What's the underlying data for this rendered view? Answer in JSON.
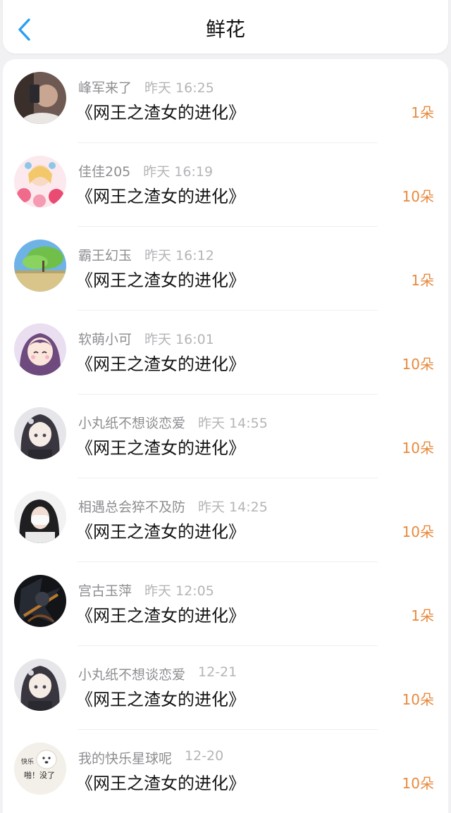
{
  "header": {
    "title": "鲜花",
    "back_icon": "chevron-left-icon",
    "accent_color": "#2a9df4"
  },
  "count_color": "#e8893c",
  "items": [
    {
      "name": "峰军来了",
      "time": "昨天 16:25",
      "book": "《网王之渣女的进化》",
      "count": "1朵",
      "avatar": "photo-avatar-icon"
    },
    {
      "name": "佳佳205",
      "time": "昨天 16:19",
      "book": "《网王之渣女的进化》",
      "count": "10朵",
      "avatar": "anime-girl-avatar-icon"
    },
    {
      "name": "霸王幻玉",
      "time": "昨天 16:12",
      "book": "《网王之渣女的进化》",
      "count": "1朵",
      "avatar": "landscape-avatar-icon"
    },
    {
      "name": "软萌小可",
      "time": "昨天 16:01",
      "book": "《网王之渣女的进化》",
      "count": "10朵",
      "avatar": "anime-girl-avatar-icon"
    },
    {
      "name": "小丸纸不想谈恋爱",
      "time": "昨天 14:55",
      "book": "《网王之渣女的进化》",
      "count": "10朵",
      "avatar": "anime-girl-avatar-icon"
    },
    {
      "name": "相遇总会猝不及防",
      "time": "昨天 14:25",
      "book": "《网王之渣女的进化》",
      "count": "10朵",
      "avatar": "photo-avatar-icon"
    },
    {
      "name": "宫古玉萍",
      "time": "昨天 12:05",
      "book": "《网王之渣女的进化》",
      "count": "1朵",
      "avatar": "dark-art-avatar-icon"
    },
    {
      "name": "小丸纸不想谈恋爱",
      "time": "12-21",
      "book": "《网王之渣女的进化》",
      "count": "10朵",
      "avatar": "anime-girl-avatar-icon"
    },
    {
      "name": "我的快乐星球呢",
      "time": "12-20",
      "book": "《网王之渣女的进化》",
      "count": "10朵",
      "avatar": "dog-meme-avatar-icon",
      "avatar_text": [
        "快乐",
        "啪！没了"
      ]
    }
  ]
}
